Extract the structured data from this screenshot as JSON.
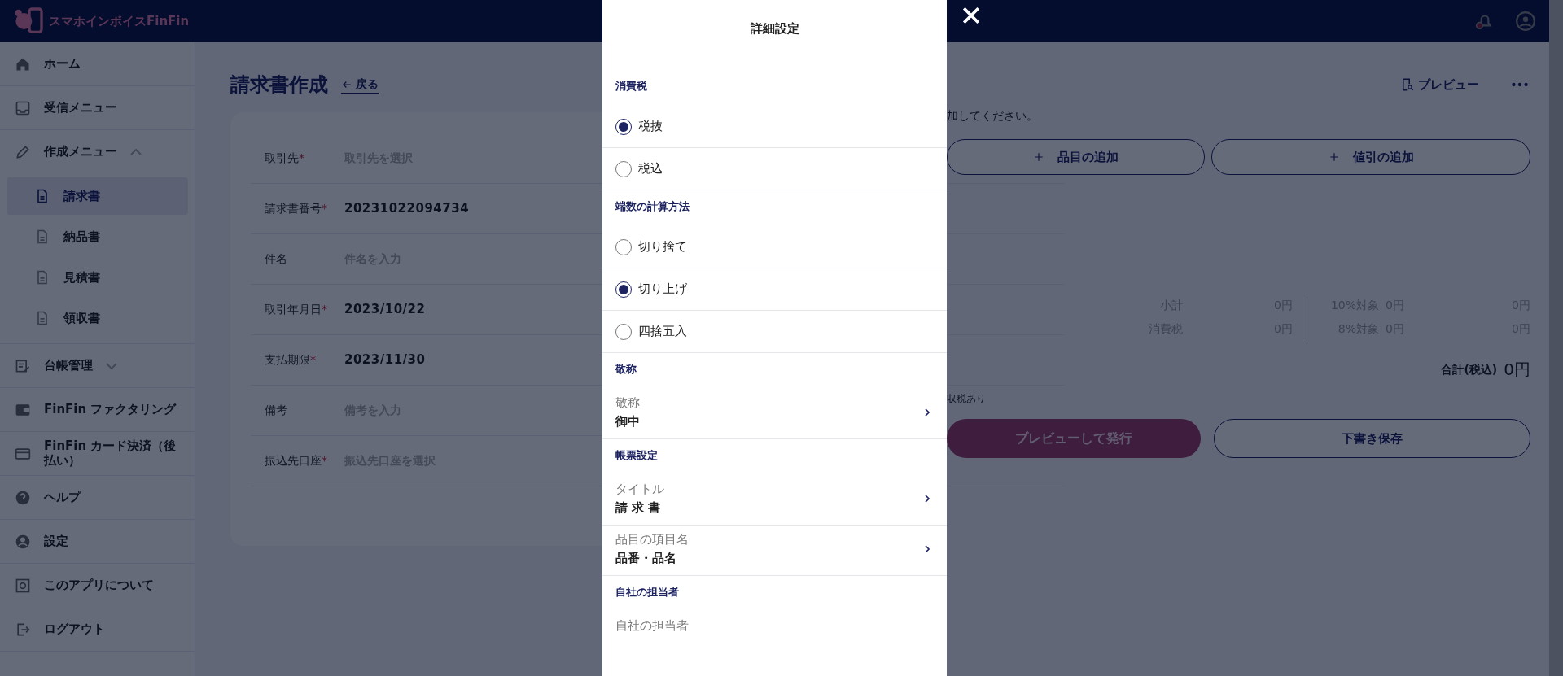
{
  "app": {
    "logo": "スマホインボイスFinFin"
  },
  "sidebar": {
    "items": [
      {
        "label": "ホーム"
      },
      {
        "label": "受信メニュー"
      },
      {
        "label": "作成メニュー",
        "expanded": true,
        "children": [
          {
            "label": "請求書",
            "selected": true
          },
          {
            "label": "納品書",
            "selected": false
          },
          {
            "label": "見積書",
            "selected": false
          },
          {
            "label": "領収書",
            "selected": false
          }
        ]
      },
      {
        "label": "台帳管理",
        "expanded": false
      },
      {
        "label": "FinFin ファクタリング"
      },
      {
        "label": "FinFin カード決済（後払い）"
      },
      {
        "label": "ヘルプ"
      },
      {
        "label": "設定"
      },
      {
        "label": "このアプリについて"
      },
      {
        "label": "ログアウト"
      }
    ]
  },
  "page": {
    "title": "請求書作成",
    "back_link": "戻る",
    "preview_button": "プレビュー"
  },
  "form": {
    "fields": [
      {
        "label": "取引先",
        "required_mark": "*",
        "placeholder": "取引先を選択"
      },
      {
        "label": "請求書番号",
        "required_mark": "*",
        "value": "20231022094734"
      },
      {
        "label": "件名",
        "placeholder": "件名を入力"
      },
      {
        "label": "取引年月日",
        "required_mark": "*",
        "value": "2023/10/22"
      },
      {
        "label": "支払期限",
        "required_mark": "*",
        "value": "2023/11/30"
      },
      {
        "label": "備考",
        "placeholder": "備考を入力"
      },
      {
        "label": "振込先口座",
        "required_mark": "*",
        "placeholder": "振込先口座を選択"
      }
    ]
  },
  "items_panel": {
    "hint": "加してください。",
    "add_item_button": "品目の追加",
    "add_discount_button": "値引の追加",
    "summary": [
      {
        "label": "小計",
        "value": "0円",
        "rate_label": "10%対象",
        "rate_base": "0円",
        "rate_value": "0円"
      },
      {
        "label": "消費税",
        "value": "0円",
        "rate_label": "8%対象",
        "rate_base": "0円",
        "rate_value": "0円"
      }
    ],
    "total_label": "合計(税込)",
    "total": "0円",
    "note": "収税あり",
    "issue_button": {
      "label": "プレビューして発行",
      "disabled": true
    },
    "save_button": "下書き保存"
  },
  "modal": {
    "title": "詳細設定",
    "sections": [
      {
        "heading": "消費税",
        "rows": [
          {
            "kind": "radio",
            "label": "税抜",
            "selected": true
          },
          {
            "kind": "radio",
            "label": "税込",
            "selected": false
          }
        ]
      },
      {
        "heading": "端数の計算方法",
        "rows": [
          {
            "kind": "radio",
            "label": "切り捨て",
            "selected": false
          },
          {
            "kind": "radio",
            "label": "切り上げ",
            "selected": true
          },
          {
            "kind": "radio",
            "label": "四捨五入",
            "selected": false
          }
        ]
      },
      {
        "heading": "敬称",
        "rows": [
          {
            "kind": "link",
            "label": "敬称",
            "value": "御中"
          }
        ]
      },
      {
        "heading": "帳票設定",
        "rows": [
          {
            "kind": "link",
            "label": "タイトル",
            "value": "請 求 書"
          },
          {
            "kind": "link",
            "label": "品目の項目名",
            "value": "品番・品名"
          }
        ]
      },
      {
        "heading": "自社の担当者",
        "rows": [
          {
            "kind": "link",
            "label": "自社の担当者"
          }
        ]
      }
    ]
  }
}
